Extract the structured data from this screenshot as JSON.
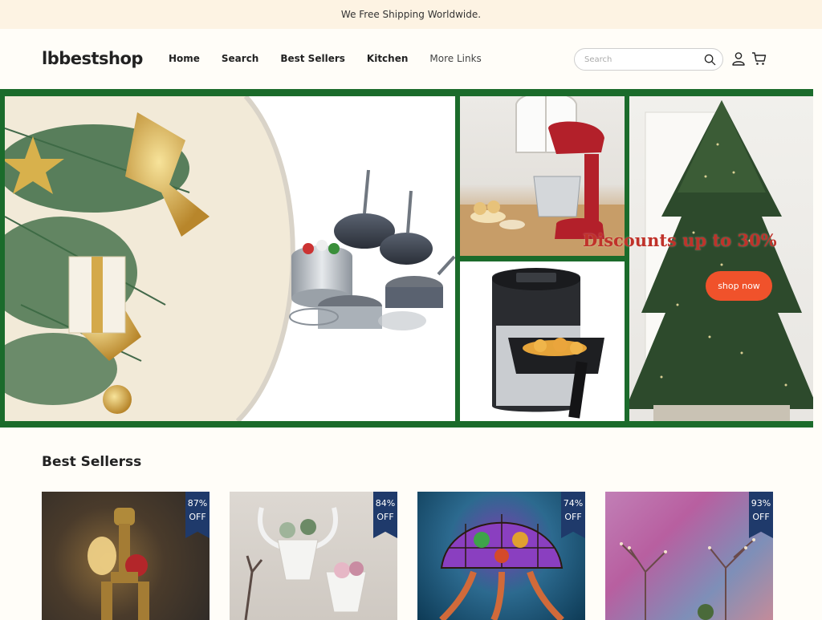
{
  "announcement": "We Free Shipping Worldwide.",
  "header": {
    "logo": "lbbestshop",
    "nav": [
      {
        "label": "Home"
      },
      {
        "label": "Search"
      },
      {
        "label": "Best Sellers"
      },
      {
        "label": "Kitchen"
      },
      {
        "label": "More Links"
      }
    ],
    "search_placeholder": "Search",
    "icons": [
      "search-icon",
      "account-icon",
      "cart-icon"
    ]
  },
  "hero": {
    "promo_text": "Discounts up to 30%",
    "cta_label": "shop now",
    "frame_color": "#1b6b2b",
    "cta_color": "#f0522b"
  },
  "best_sellers": {
    "title": "Best Sellerss",
    "products": [
      {
        "discount": "87%",
        "off": "OFF"
      },
      {
        "discount": "84%",
        "off": "OFF"
      },
      {
        "discount": "74%",
        "off": "OFF"
      },
      {
        "discount": "93%",
        "off": "OFF"
      }
    ],
    "ribbon_color": "#1f3a6b"
  }
}
